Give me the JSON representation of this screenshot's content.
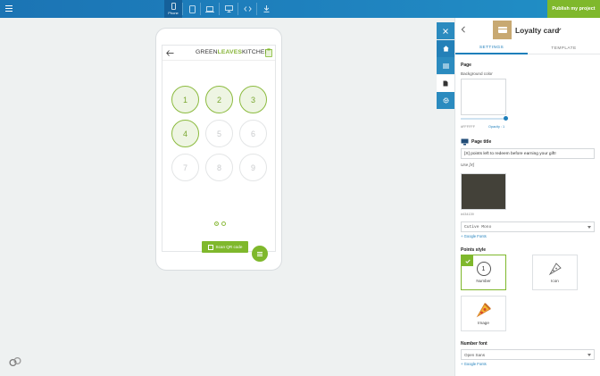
{
  "topbar": {
    "devices": [
      {
        "name": "phone",
        "label": "Phone"
      },
      {
        "name": "tablet",
        "label": ""
      },
      {
        "name": "laptop",
        "label": ""
      },
      {
        "name": "desktop",
        "label": ""
      },
      {
        "name": "code",
        "label": ""
      },
      {
        "name": "download",
        "label": ""
      }
    ],
    "publish_label": "Publish my project",
    "colors": {
      "bar": "#1f83bf",
      "publish": "#7fb82c"
    }
  },
  "preview": {
    "logo_part1": "GREEN",
    "logo_part2": "LEAVES",
    "logo_part3": "KITCHEN",
    "stamps": [
      {
        "label": "1",
        "filled": true
      },
      {
        "label": "2",
        "filled": true
      },
      {
        "label": "3",
        "filled": true
      },
      {
        "label": "4",
        "filled": true
      },
      {
        "label": "5",
        "filled": false
      },
      {
        "label": "6",
        "filled": false
      },
      {
        "label": "7",
        "filled": false
      },
      {
        "label": "8",
        "filled": false
      },
      {
        "label": "9",
        "filled": false
      }
    ],
    "scan_label": "Scan QR code",
    "accent": "#7fb82c"
  },
  "side_tools": [
    "close-icon",
    "home-icon",
    "list-icon",
    "page-icon",
    "gear-icon"
  ],
  "panel": {
    "title": "Loyalty card",
    "tabs": {
      "settings": "SETTINGS",
      "template": "TEMPLATE"
    },
    "page_section": "Page",
    "background_label": "Background color",
    "background_hex": "#FFFFFF",
    "opacity_label": "Opacity : 1",
    "page_title_label": "Page title",
    "page_title_value": "[X] points left to redeem before earning your gift!",
    "use_hint": "Use [X]",
    "title_color_hex": "#434139",
    "title_font": "Cutive Mono",
    "google_fonts": "+ Google Fonts",
    "points_style_label": "Points style",
    "styles": {
      "number": "Number",
      "icon": "Icon",
      "image": "Image"
    },
    "number_preview": "1",
    "number_font_label": "Number font",
    "number_font": "Open Sans",
    "google_fonts_2": "+ Google Fonts"
  }
}
